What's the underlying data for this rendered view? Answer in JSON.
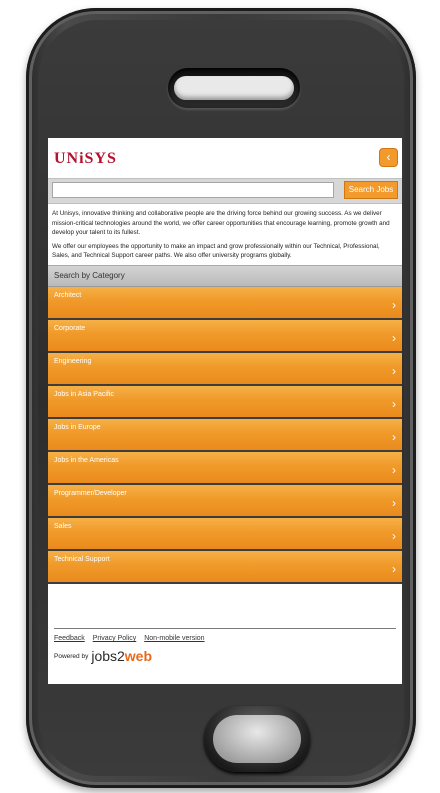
{
  "brand": {
    "logo_text": "UNiSYS"
  },
  "top": {
    "back_icon": "chevron-left"
  },
  "search": {
    "placeholder": "",
    "button_label": "Search Jobs"
  },
  "intro": {
    "p1": "At Unisys, innovative thinking and collaborative people are the driving force behind our growing success. As we deliver mission-critical technologies around the world, we offer career opportunities that encourage learning, promote growth and develop your talent to its fullest.",
    "p2": "We offer our employees the opportunity to make an impact and grow professionally within our Technical, Professional, Sales, and Technical Support career paths. We also offer university programs globally."
  },
  "categories": {
    "header": "Search by Category",
    "items": [
      "Architect",
      "Corporate",
      "Engineering",
      "Jobs in Asia Pacific",
      "Jobs in Europe",
      "Jobs in the Americas",
      "Programmer/Developer",
      "Sales",
      "Technical Support"
    ]
  },
  "footer": {
    "links": [
      "Feedback",
      "Privacy Policy",
      "Non-mobile version"
    ],
    "powered_by": "Powered by",
    "brand_a": "jobs2",
    "brand_b": "web"
  },
  "colors": {
    "accent": "#f09a2a",
    "brand_red": "#b3122f"
  }
}
